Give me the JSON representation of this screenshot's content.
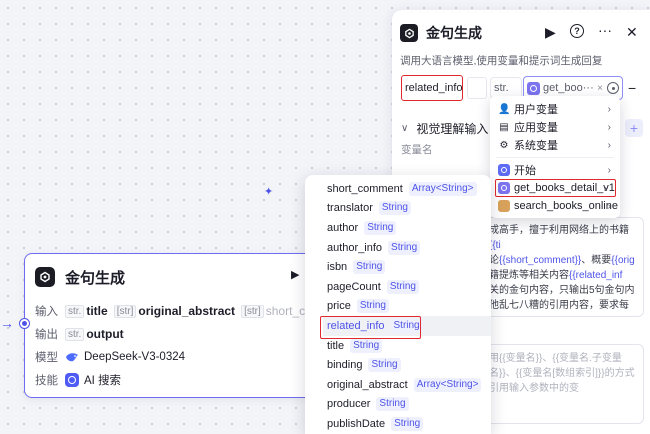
{
  "node": {
    "title": "金句生成",
    "run_icon": "play-icon",
    "inputs_label": "输入",
    "inputs": [
      {
        "prefix": "str.",
        "name": "title"
      },
      {
        "prefix": "[str]",
        "name": "original_abstract"
      },
      {
        "prefix": "[str]",
        "name": "short_co"
      }
    ],
    "outputs_label": "输出",
    "outputs": [
      {
        "prefix": "str.",
        "name": "output"
      }
    ],
    "model_label": "模型",
    "model_name": "DeepSeek-V3-0324",
    "skills_label": "技能",
    "skill_name": "AI 搜索"
  },
  "panel": {
    "title": "金句生成",
    "description": "调用大语言模型,使用变量和提示词生成回复",
    "more_icon": "···",
    "close_icon": "✕",
    "help_icon": "?",
    "param_name": "related_info",
    "param_type": "str.",
    "param_ref": "get_boo···",
    "ref_clear": "×",
    "minus": "−",
    "vision_section": "视觉理解输入",
    "var_name_label": "变量名",
    "add": "+",
    "system_prompt_lines": [
      {
        "t": "成高手，擅于利用网络上的书籍"
      },
      {
        "t": "{{ti",
        "hl": true
      },
      {
        "t": "论"
      },
      {
        "t": "{{short_comment}}",
        "hl": true
      },
      {
        "t": "、概要"
      },
      {
        "t": "{{orig",
        "hl": true
      },
      {
        "t": "籍提炼等相关内容"
      },
      {
        "t": "{{related_inf",
        "hl": true
      },
      {
        "t": "关的金句内容，只输出5句金句内"
      },
      {
        "t": "他乱七八糟的引用内容，要求每一"
      },
      {
        "t": "个字的时候，就要换行。"
      }
    ],
    "user_prompt": "用{{变量名}}、{{变量名.子变量名}}、{{变量名[数组索引]}}的方式引用输入参数中的变"
  },
  "var_menu": {
    "groups": [
      {
        "icon": "user-icon",
        "glyph": "👤",
        "label": "用户变量"
      },
      {
        "icon": "app-icon",
        "glyph": "▤",
        "label": "应用变量"
      },
      {
        "icon": "gear-icon",
        "glyph": "⚙",
        "label": "系统变量"
      }
    ],
    "sources": [
      {
        "icon": "start-icon",
        "cls": "start",
        "label": "开始"
      },
      {
        "icon": "get-books-detail-icon",
        "cls": "detail",
        "label": "get_books_detail_v1"
      },
      {
        "icon": "search-books-icon",
        "cls": "search",
        "label": "search_books_online"
      }
    ]
  },
  "fields": [
    {
      "name": "short_comment",
      "type": "Array<String>"
    },
    {
      "name": "translator",
      "type": "String"
    },
    {
      "name": "author",
      "type": "String"
    },
    {
      "name": "author_info",
      "type": "String"
    },
    {
      "name": "isbn",
      "type": "String"
    },
    {
      "name": "pageCount",
      "type": "String"
    },
    {
      "name": "price",
      "type": "String"
    },
    {
      "name": "related_info",
      "type": "String",
      "active": true
    },
    {
      "name": "title",
      "type": "String"
    },
    {
      "name": "binding",
      "type": "String"
    },
    {
      "name": "original_abstract",
      "type": "Array<String>"
    },
    {
      "name": "producer",
      "type": "String"
    },
    {
      "name": "publishDate",
      "type": "String"
    }
  ]
}
